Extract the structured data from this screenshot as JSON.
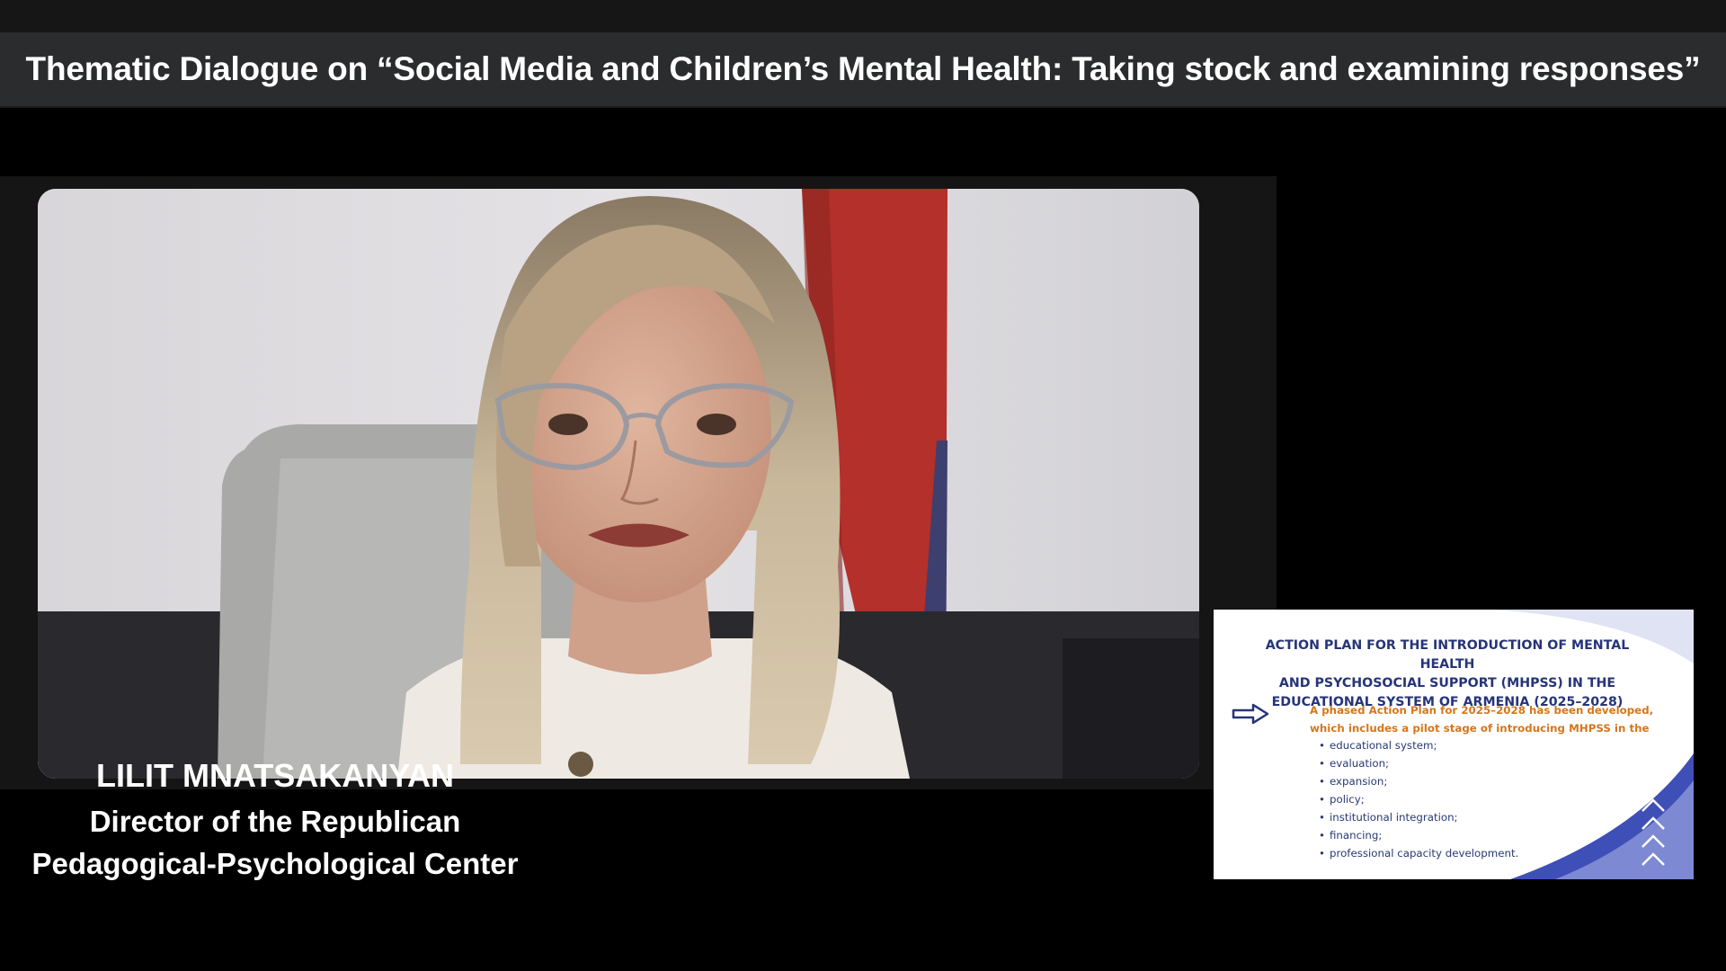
{
  "header": {
    "title": "Thematic Dialogue on “Social Media and Children’s Mental Health: Taking stock and examining responses”"
  },
  "speaker": {
    "name": "LILIT MNATSAKANYAN",
    "role_line1": "Director of the Republican",
    "role_line2": "Pedagogical-Psychological Center"
  },
  "slide": {
    "title_line1": "ACTION PLAN FOR THE INTRODUCTION OF MENTAL HEALTH",
    "title_line2": "AND PSYCHOSOCIAL SUPPORT (MHPSS) IN THE",
    "title_line3": "EDUCATIONAL SYSTEM OF ARMENIA (2025–2028)",
    "lead_line1": "A phased Action Plan for 2025–2028 has been developed,",
    "lead_line2": "which includes a pilot stage of introducing MHPSS in the",
    "bullets": [
      "educational system;",
      "evaluation;",
      "expansion;",
      "policy;",
      "institutional integration;",
      "financing;",
      "professional capacity development."
    ],
    "arrow_icon": "arrow-right-outline-icon",
    "chevrons_icon": "chevrons-up-icon"
  },
  "colors": {
    "background": "#000000",
    "title_bar": "#2b2c2e",
    "slide_title": "#26347a",
    "slide_lead": "#d6761a",
    "slide_accent": "#3f4fb8"
  }
}
